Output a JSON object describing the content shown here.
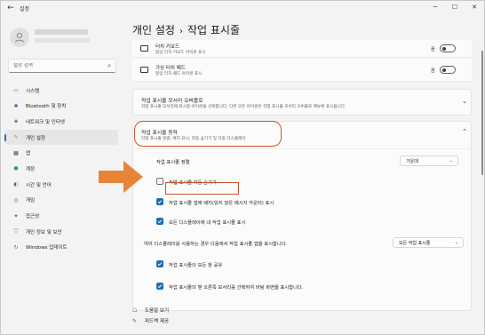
{
  "titlebar": {
    "back_label": "←",
    "app_title": "설정",
    "minimize": "─",
    "maximize": "☐",
    "close": "✕"
  },
  "sidebar": {
    "search_placeholder": "설정 검색",
    "items": [
      {
        "label": "시스템",
        "icon": "monitor-icon",
        "glyph": "▭",
        "color": "#2f6fa8"
      },
      {
        "label": "Bluetooth 및 장치",
        "icon": "bluetooth-icon",
        "glyph": "✱",
        "color": "#2f6fa8"
      },
      {
        "label": "네트워크 및 인터넷",
        "icon": "wifi-icon",
        "glyph": "◈",
        "color": "#2f6fa8"
      },
      {
        "label": "개인 설정",
        "icon": "brush-icon",
        "glyph": "✎",
        "color": "#c17d2d",
        "active": true
      },
      {
        "label": "앱",
        "icon": "apps-icon",
        "glyph": "▦",
        "color": "#4b4b4b"
      },
      {
        "label": "계정",
        "icon": "person-icon",
        "glyph": "●",
        "color": "#2e9a5e"
      },
      {
        "label": "시간 및 언어",
        "icon": "globe-clock-icon",
        "glyph": "◐",
        "color": "#2f6fa8"
      },
      {
        "label": "게임",
        "icon": "gamepad-icon",
        "glyph": "◎",
        "color": "#6b6b6b"
      },
      {
        "label": "접근성",
        "icon": "accessibility-icon",
        "glyph": "✦",
        "color": "#2f6fa8"
      },
      {
        "label": "개인 정보 및 보안",
        "icon": "shield-icon",
        "glyph": "⛉",
        "color": "#6b6b6b"
      },
      {
        "label": "Windows 업데이트",
        "icon": "update-icon",
        "glyph": "↻",
        "color": "#2f6fa8"
      }
    ]
  },
  "breadcrumb": {
    "parent": "개인 설정",
    "separator": "›",
    "current": "작업 표시줄"
  },
  "rows": {
    "touch_keyboard": {
      "title": "터치 키보드",
      "sub": "항상 터치 키보드 아이콘 표시",
      "toggle": "끔"
    },
    "virtual_touchpad": {
      "title": "가상 터치 패드",
      "sub": "항상 터치 패드 아이콘 표시",
      "toggle": "끔"
    }
  },
  "overflow_section": {
    "title": "작업 표시줄 모서리 오버플로",
    "sub": "작업 표시줄 모서리에 표시할 아이콘을 선택합니다. 다른 모든 아이콘은 작업 표시줄 모서리 오버플로 메뉴에 표시됩니다."
  },
  "behaviors_section": {
    "title": "작업 표시줄 동작",
    "sub": "작업 표시줄 정렬, 배지 표시, 자동 숨기기 및 다중 디스플레이",
    "alignment_label": "작업 표시줄 정렬",
    "alignment_value": "가운데",
    "options": [
      {
        "label": "작업 표시줄 자동 숨기기",
        "checked": false
      },
      {
        "label": "작업 표시줄 앱에 배지(읽지 않은 메시지 카운터) 표시",
        "checked": true
      },
      {
        "label": "모든 디스플레이에 내 작업 표시줄 표시",
        "checked": true
      }
    ],
    "multi_display_label": "여러 디스플레이를 사용하는 경우 다음에서 작업 표시줄 앱을 표시합니다.",
    "multi_display_value": "모든 작업 표시줄",
    "options2": [
      {
        "label": "작업 표시줄의 모든 창 공유",
        "checked": true
      },
      {
        "label": "작업 표시줄의 맨 오른쪽 모서리를 선택하여 바탕 화면을 표시합니다.",
        "checked": true
      }
    ]
  },
  "footer": {
    "help": "도움말 보기",
    "feedback": "피드백 제공"
  },
  "colors": {
    "accent": "#1f6eb4",
    "annotation": "#c5562a",
    "arrow": "#e8833a"
  }
}
